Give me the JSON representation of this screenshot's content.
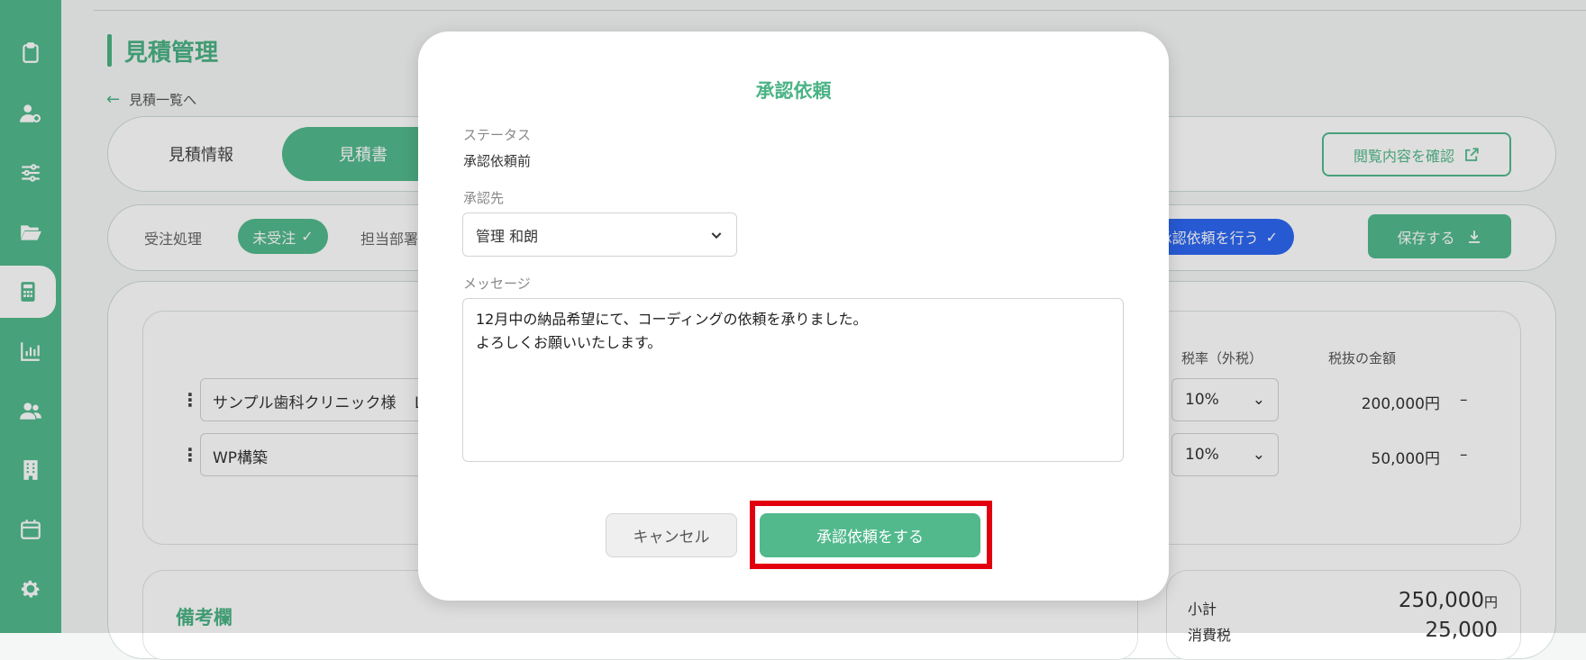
{
  "sidebar": {
    "items": [
      {
        "icon": "clipboard-icon"
      },
      {
        "icon": "user-gear-icon"
      },
      {
        "icon": "sliders-icon"
      },
      {
        "icon": "folder-open-icon"
      },
      {
        "icon": "calculator-icon",
        "active": true
      },
      {
        "icon": "bar-chart-icon"
      },
      {
        "icon": "users-icon"
      },
      {
        "icon": "building-icon"
      },
      {
        "icon": "calendar-icon"
      },
      {
        "icon": "gear-icon"
      }
    ]
  },
  "header": {
    "title": "見積管理",
    "back_link": "見積一覧へ"
  },
  "tabs": [
    {
      "label": "見積情報",
      "active": false
    },
    {
      "label": "見積書",
      "active": true
    }
  ],
  "view_button": "閲覧内容を確認",
  "order_bar": {
    "label": "受注処理",
    "status_pill": "未受注",
    "dept_label": "担当部署",
    "request_pill": "承認依頼を行う",
    "save_button": "保存する"
  },
  "items_table": {
    "headers": {
      "tax_rate": "税率（外税）",
      "amount": "税抜の金額"
    },
    "rows": [
      {
        "name": "サンプル歯科クリニック様　Ｌ",
        "tax": "10%",
        "amount": "200,000円",
        "dash": "–"
      },
      {
        "name": "WP構築",
        "tax": "10%",
        "amount": "50,000円",
        "dash": "–"
      }
    ]
  },
  "notes": {
    "title": "備考欄"
  },
  "totals": {
    "subtotal_label": "小計",
    "subtotal_value": "250,000",
    "tax_label": "消費税",
    "tax_value": "25,000",
    "currency": "円"
  },
  "modal": {
    "title": "承認依頼",
    "status_label": "ステータス",
    "status_value": "承認依頼前",
    "approver_label": "承認先",
    "approver_value": "管理 和朗",
    "message_label": "メッセージ",
    "message_value": "12月中の納品希望にて、コーディングの依頼を承りました。\nよろしくお願いいたします。",
    "cancel_button": "キャンセル",
    "submit_button": "承認依頼をする"
  },
  "colors": {
    "brand": "#52b98d",
    "accent_blue": "#2c67f2",
    "highlight": "#e2000f"
  }
}
